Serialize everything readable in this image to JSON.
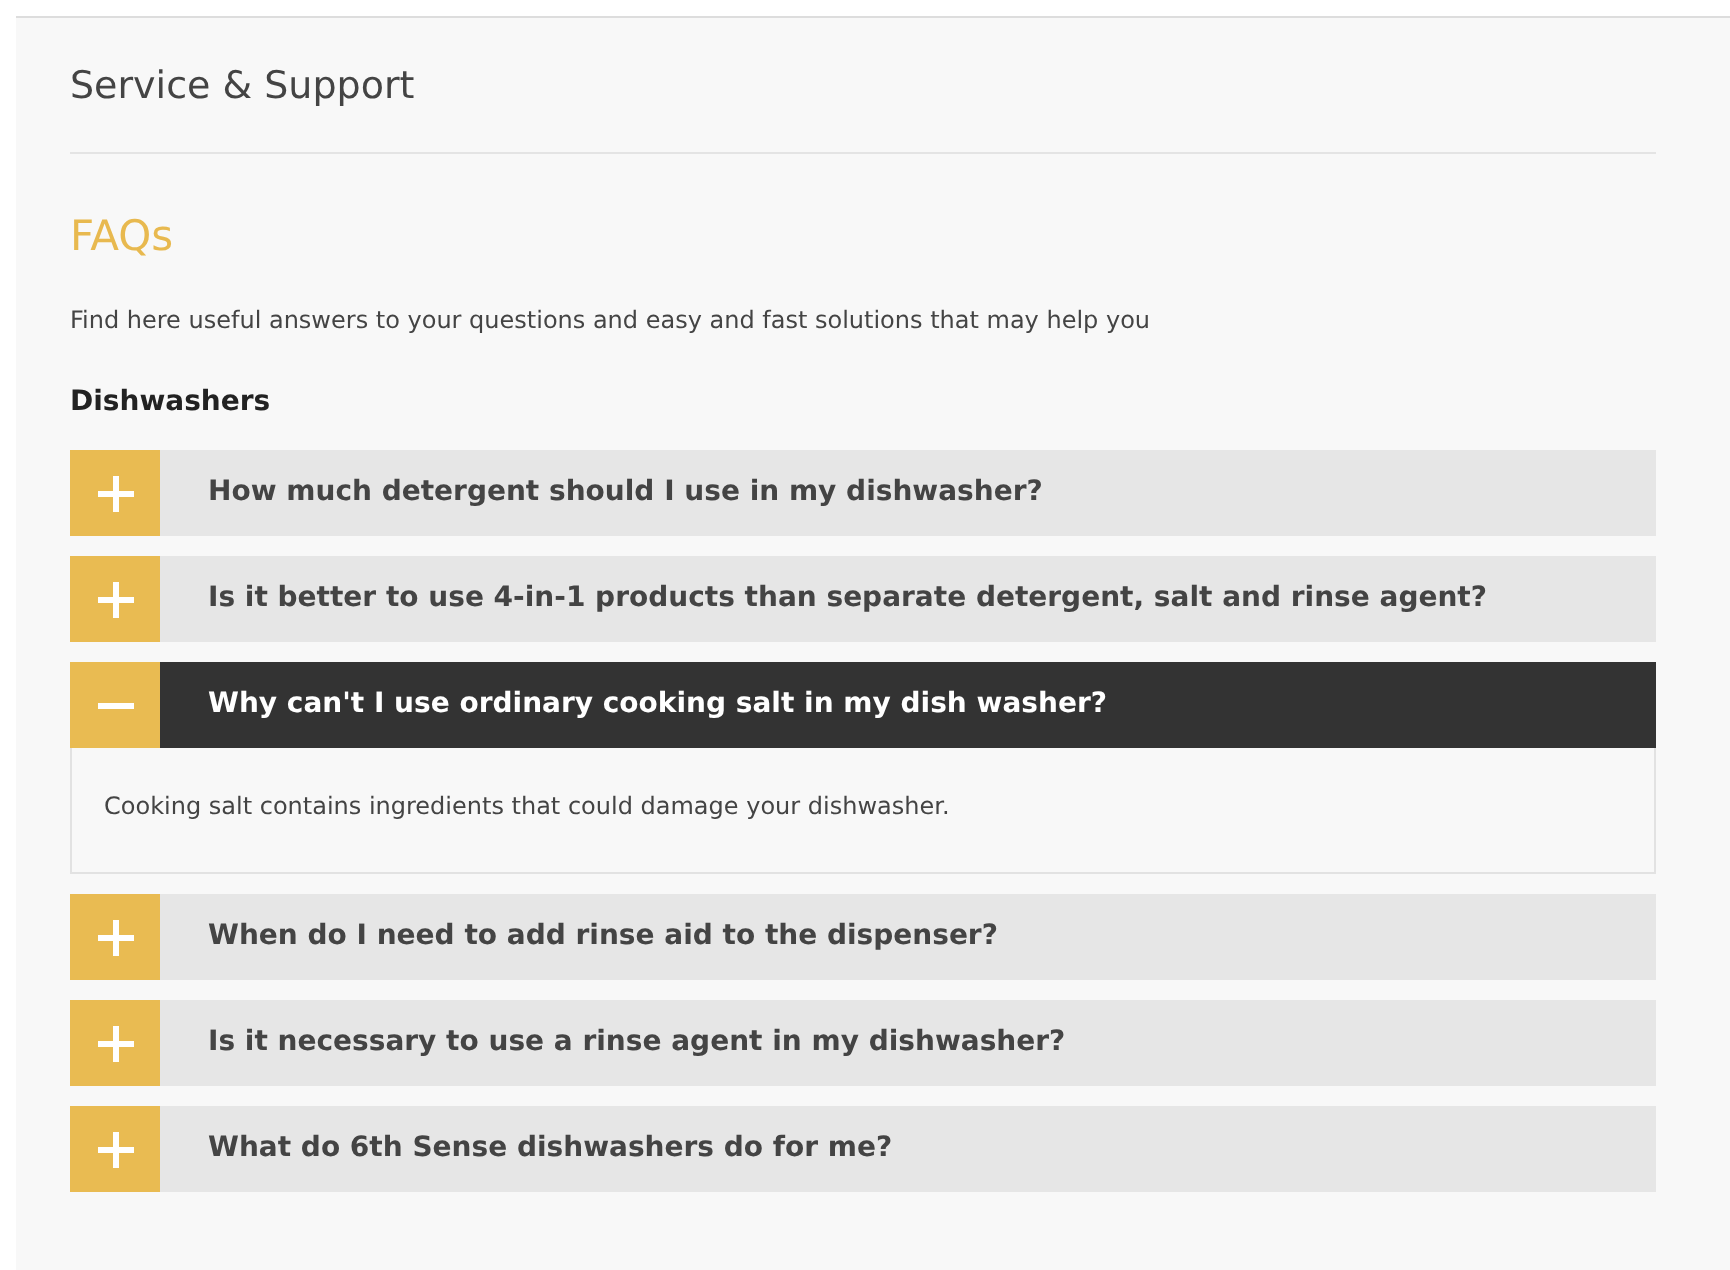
{
  "header": {
    "title": "Service & Support"
  },
  "faq": {
    "title": "FAQs",
    "intro": "Find here useful answers to your questions and easy and fast solutions that may help you",
    "category": "Dishwashers",
    "items": [
      {
        "question": "How much detergent should I use in my dishwasher?",
        "expanded": false
      },
      {
        "question": "Is it better to use 4-in-1 products than separate detergent, salt and rinse agent?",
        "expanded": false
      },
      {
        "question": "Why can't I use ordinary cooking salt in my dish washer?",
        "expanded": true,
        "answer": "Cooking salt contains ingredients that could damage your dishwasher."
      },
      {
        "question": "When do I need to add rinse aid to the dispenser?",
        "expanded": false
      },
      {
        "question": "Is it necessary to use a rinse agent in my dishwasher?",
        "expanded": false
      },
      {
        "question": "What do 6th Sense dishwashers do for me?",
        "expanded": false
      }
    ]
  }
}
